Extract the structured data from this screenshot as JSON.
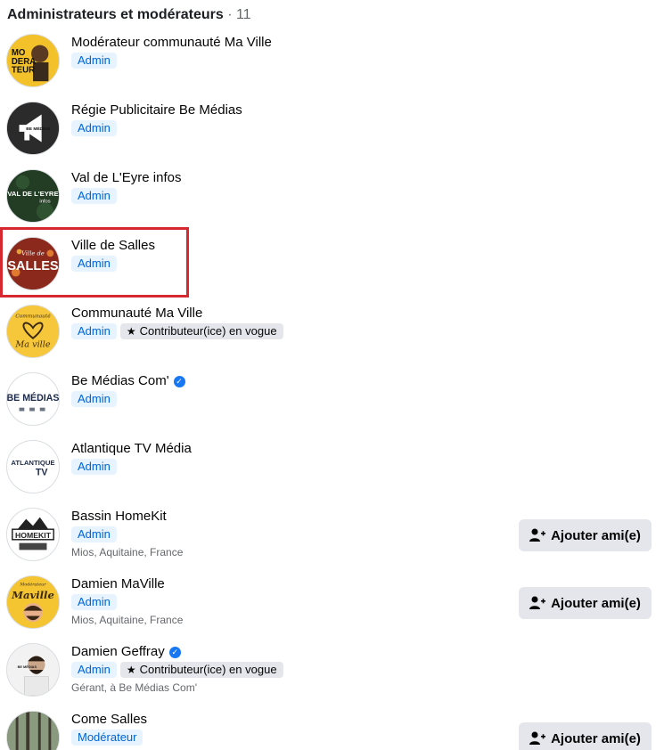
{
  "header": {
    "title": "Administrateurs et modérateurs",
    "count": "· 11"
  },
  "members": [
    {
      "name": "Modérateur communauté Ma Ville",
      "role": "Admin",
      "avatar_text": "MO DERA TEUR"
    },
    {
      "name": "Régie Publicitaire Be Médias",
      "role": "Admin",
      "avatar_text": "BE MÉDIAS"
    },
    {
      "name": "Val de L'Eyre infos",
      "role": "Admin",
      "avatar_text": "VAL DE L'EYRE",
      "avatar_subtext": "infos"
    },
    {
      "name": "Ville de Salles",
      "role": "Admin",
      "avatar_text": "SALLES",
      "avatar_subtext": "Ville de"
    },
    {
      "name": "Communauté Ma Ville",
      "role": "Admin",
      "extra_badge": "Contributeur(ice) en vogue",
      "avatar_text": "Ma ville",
      "avatar_subtext": "Communauté"
    },
    {
      "name": "Be Médias Com'",
      "role": "Admin",
      "verified": true,
      "avatar_text": "BE MÉDIAS"
    },
    {
      "name": "Atlantique TV Média",
      "role": "Admin",
      "avatar_text": "ATLANTIQUE",
      "avatar_subtext": "TV"
    },
    {
      "name": "Bassin HomeKit",
      "role": "Admin",
      "subtitle": "Mios, Aquitaine, France",
      "avatar_text": "HOMEKIT",
      "action": "Ajouter ami(e)"
    },
    {
      "name": "Damien MaVille",
      "role": "Admin",
      "subtitle": "Mios, Aquitaine, France",
      "avatar_text": "Maville",
      "avatar_subtext": "Modérateur",
      "action": "Ajouter ami(e)"
    },
    {
      "name": "Damien Geffray",
      "role": "Admin",
      "verified": true,
      "extra_badge": "Contributeur(ice) en vogue",
      "subtitle": "Gérant, à Be Médias Com'",
      "avatar_text": "BE MÉDIAS"
    },
    {
      "name": "Come Salles",
      "role": "Modérateur",
      "action": "Ajouter ami(e)"
    }
  ],
  "colors": {
    "highlight": "#d7282f",
    "badge_bg": "#e7f3ff",
    "badge_text": "#0064d1",
    "button_bg": "#e4e6eb",
    "verified": "#1877f2"
  }
}
